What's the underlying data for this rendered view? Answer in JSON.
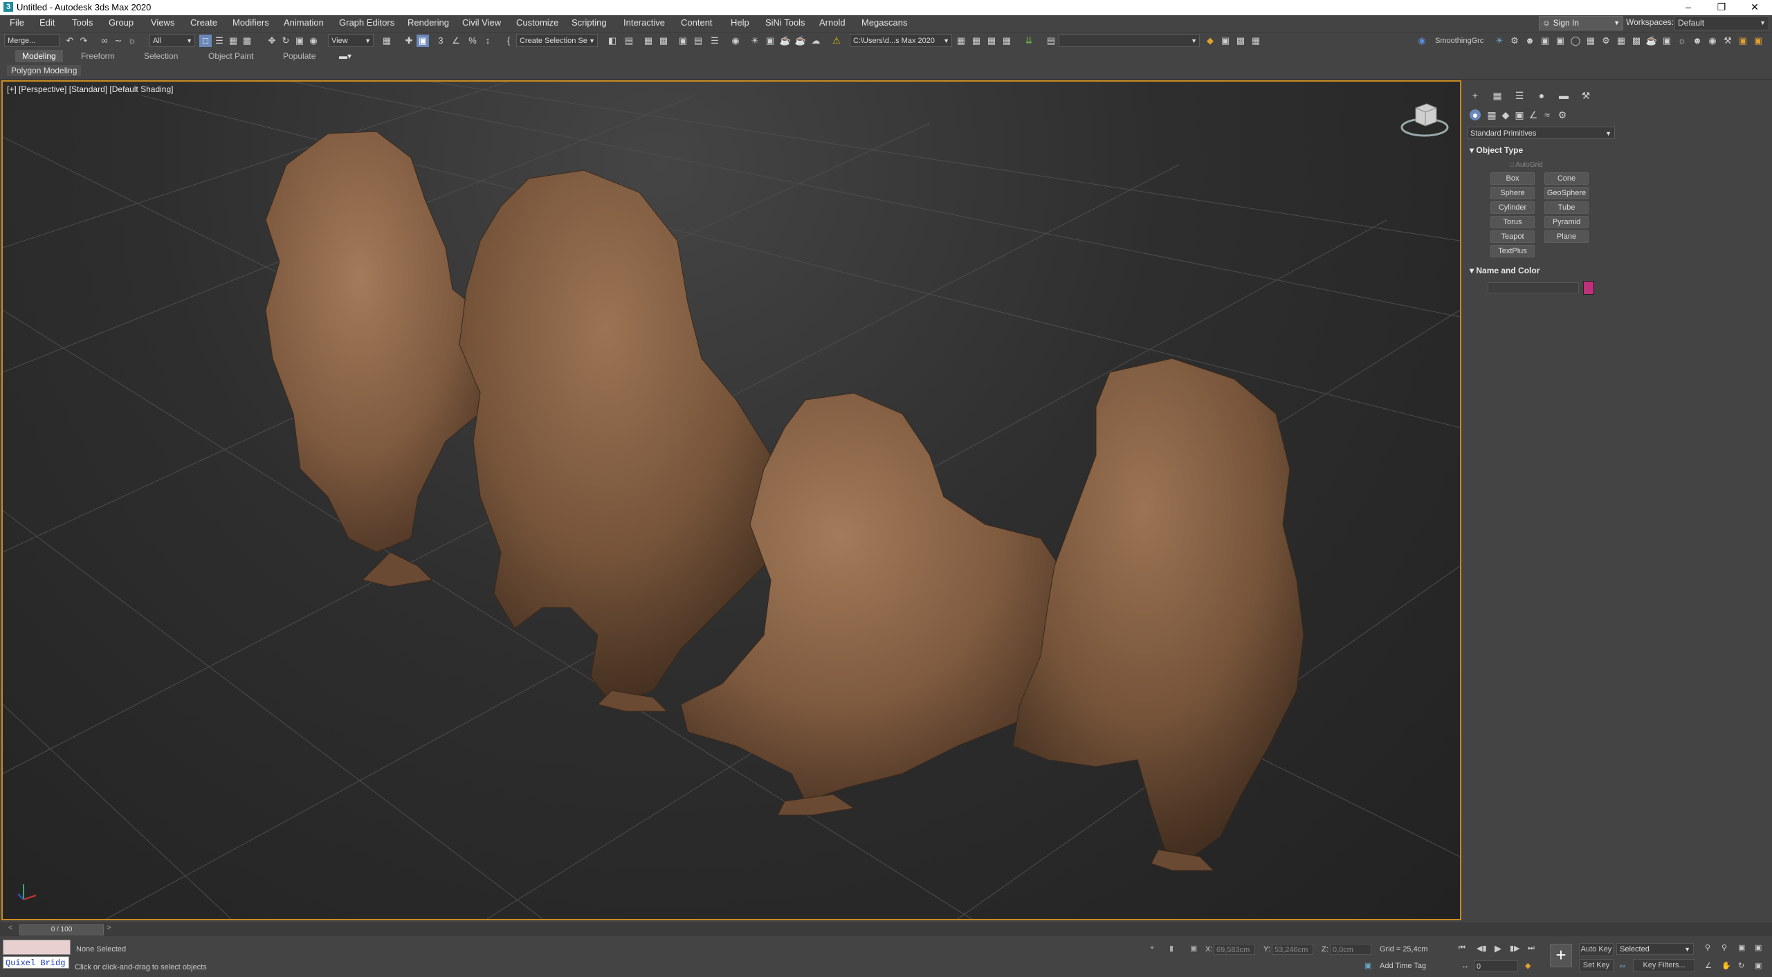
{
  "window": {
    "title": "Untitled - Autodesk 3ds Max 2020",
    "minimize": "–",
    "maximize": "❐",
    "close": "✕"
  },
  "menubar": {
    "items": [
      "File",
      "Edit",
      "Tools",
      "Group",
      "Views",
      "Create",
      "Modifiers",
      "Animation",
      "Graph Editors",
      "Rendering",
      "Civil View",
      "Customize",
      "Scripting",
      "Interactive",
      "Content",
      "Help",
      "SiNi Tools",
      "Arnold",
      "Megascans"
    ],
    "sign_in": "Sign In",
    "workspaces_label": "Workspaces:",
    "workspaces_value": "Default"
  },
  "toolbar": {
    "merge": "Merge...",
    "filter": "All",
    "reference_coord": "View",
    "create_selection_set": "Create Selection Se",
    "project_path": "C:\\Users\\d...s Max 2020",
    "smoothing_group": "SmoothingGrc"
  },
  "ribbon": {
    "tabs": [
      "Modeling",
      "Freeform",
      "Selection",
      "Object Paint",
      "Populate"
    ],
    "active_tab": "Modeling",
    "sub": "Polygon Modeling"
  },
  "viewport": {
    "label": "[+] [Perspective] [Standard] [Default Shading]"
  },
  "command_panel": {
    "category": "Standard Primitives",
    "object_type_title": "Object Type",
    "autogrid": "AutoGrid",
    "primitives": [
      "Box",
      "Cone",
      "Sphere",
      "GeoSphere",
      "Cylinder",
      "Tube",
      "Torus",
      "Pyramid",
      "Teapot",
      "Plane",
      "TextPlus"
    ],
    "name_color_title": "Name and Color",
    "object_color": "#c0307a"
  },
  "timeline": {
    "frame": "0 / 100"
  },
  "status": {
    "quixel": "Quixel Bridg",
    "selection": "None Selected",
    "prompt": "Click or click-and-drag to select objects",
    "x_label": "X:",
    "x_value": "69,583cm",
    "y_label": "Y:",
    "y_value": "53,246cm",
    "z_label": "Z:",
    "z_value": "0,0cm",
    "grid": "Grid = 25,4cm",
    "add_time_tag": "Add Time Tag",
    "auto_key": "Auto Key",
    "set_key": "Set Key",
    "selected": "Selected",
    "key_filters": "Key Filters...",
    "frame_input": "0"
  },
  "colors": {
    "viewport_border": "#c98a22",
    "lion": "#8a6346"
  }
}
